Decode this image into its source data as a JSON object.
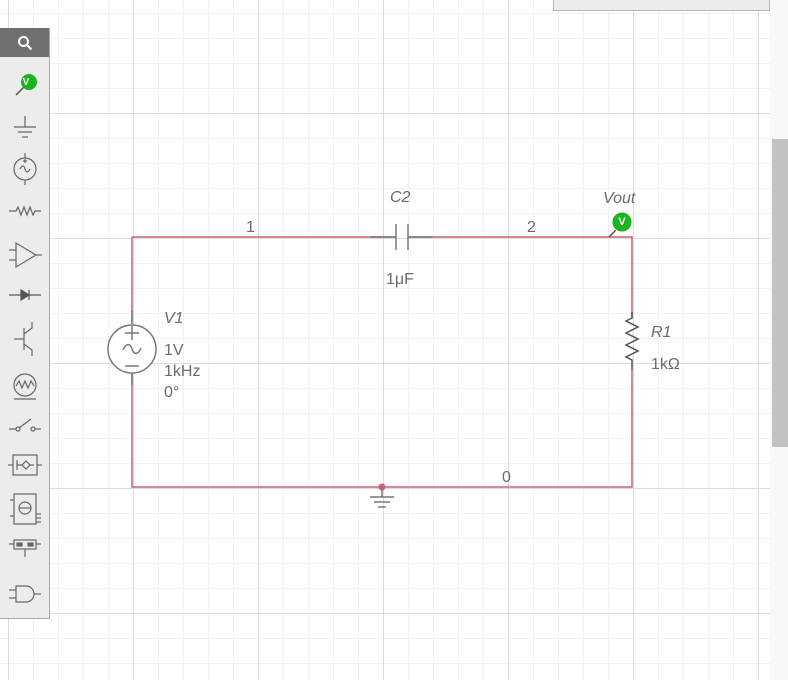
{
  "palette": {
    "search_icon": "search-icon",
    "items": [
      {
        "name": "voltage-probe-icon",
        "probe_letter": "V"
      },
      {
        "name": "ground-icon"
      },
      {
        "name": "ac-source-icon"
      },
      {
        "name": "resistor-icon"
      },
      {
        "name": "opamp-icon"
      },
      {
        "name": "diode-icon"
      },
      {
        "name": "transistor-icon"
      },
      {
        "name": "lamp-icon"
      },
      {
        "name": "switch-icon"
      },
      {
        "name": "relay-icon"
      },
      {
        "name": "ic-chip-icon"
      },
      {
        "name": "connector-icon"
      },
      {
        "name": "logic-gate-icon"
      }
    ]
  },
  "circuit": {
    "wire_color": "#c96470",
    "probe_color": "#19b41e",
    "nodes": {
      "n1": "1",
      "n2": "2",
      "n0": "0"
    },
    "c2": {
      "label": "C2",
      "value": "1μF"
    },
    "vout": {
      "label": "Vout",
      "probe_letter": "V"
    },
    "v1": {
      "label": "V1",
      "amplitude": "1V",
      "frequency": "1kHz",
      "phase": "0°"
    },
    "r1": {
      "label": "R1",
      "value": "1kΩ"
    }
  }
}
